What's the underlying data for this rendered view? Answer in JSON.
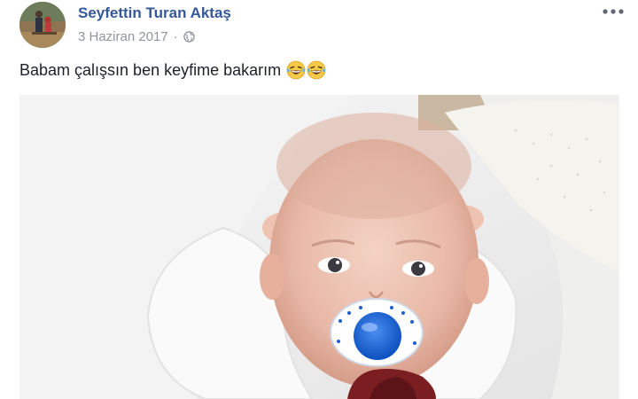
{
  "post": {
    "author": "Seyfettin Turan Aktaş",
    "date": "3 Haziran 2017",
    "separator": "·",
    "privacy_icon": "globe-icon",
    "more_icon": "ellipsis-icon",
    "caption": "Babam çalışsın ben keyfime bakarım",
    "caption_emojis": [
      "laughing-tears-emoji",
      "laughing-tears-emoji"
    ],
    "photo_subject": "baby-with-pacifier-photo"
  },
  "colors": {
    "author_link": "#365899",
    "meta_text": "#90949c",
    "body_text": "#1d2129"
  }
}
